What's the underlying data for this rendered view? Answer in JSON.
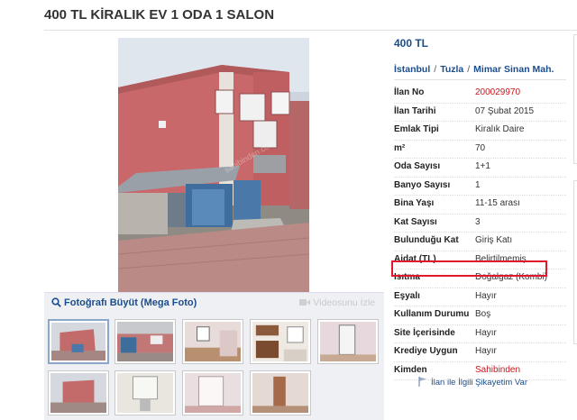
{
  "listing": {
    "title": "400 TL KİRALIK EV 1 ODA 1 SALON",
    "price": "400 TL",
    "breadcrumb": [
      "İstanbul",
      "Tuzla",
      "Mimar Sinan Mah."
    ]
  },
  "gallery": {
    "zoom_label": "Fotoğrafı Büyüt (Mega Foto)",
    "video_label": "Videosunu İzle",
    "watermark": "sahibinden.com",
    "thumb_count": 10,
    "selected_thumb": 1
  },
  "details": [
    {
      "key": "İlan No",
      "value": "200029970",
      "color": "#c4161c"
    },
    {
      "key": "İlan Tarihi",
      "value": "07 Şubat 2015"
    },
    {
      "key": "Emlak Tipi",
      "value": "Kiralık Daire"
    },
    {
      "key": "m²",
      "value": "70"
    },
    {
      "key": "Oda Sayısı",
      "value": "1+1"
    },
    {
      "key": "Banyo Sayısı",
      "value": "1"
    },
    {
      "key": "Bina Yaşı",
      "value": "11-15 arası"
    },
    {
      "key": "Kat Sayısı",
      "value": "3"
    },
    {
      "key": "Bulunduğu Kat",
      "value": "Giriş Katı"
    },
    {
      "key": "Aidat (TL)",
      "value": "Belirtilmemiş"
    },
    {
      "key": "Isıtma",
      "value": "Doğalgaz (Kombi)",
      "highlighted": true
    },
    {
      "key": "Eşyalı",
      "value": "Hayır"
    },
    {
      "key": "Kullanım Durumu",
      "value": "Boş"
    },
    {
      "key": "Site İçerisinde",
      "value": "Hayır"
    },
    {
      "key": "Krediye Uygun",
      "value": "Hayır"
    },
    {
      "key": "Kimden",
      "value": "Sahibinden",
      "color": "#c4161c"
    }
  ],
  "report_label": "İlan ile İlgili Şikayetim Var",
  "colors": {
    "link": "#1b4d8c",
    "accent_red": "#c4161c",
    "highlight_border": "#e0182d"
  },
  "icons": [
    "search-icon",
    "video-camera-icon",
    "flag-icon"
  ]
}
